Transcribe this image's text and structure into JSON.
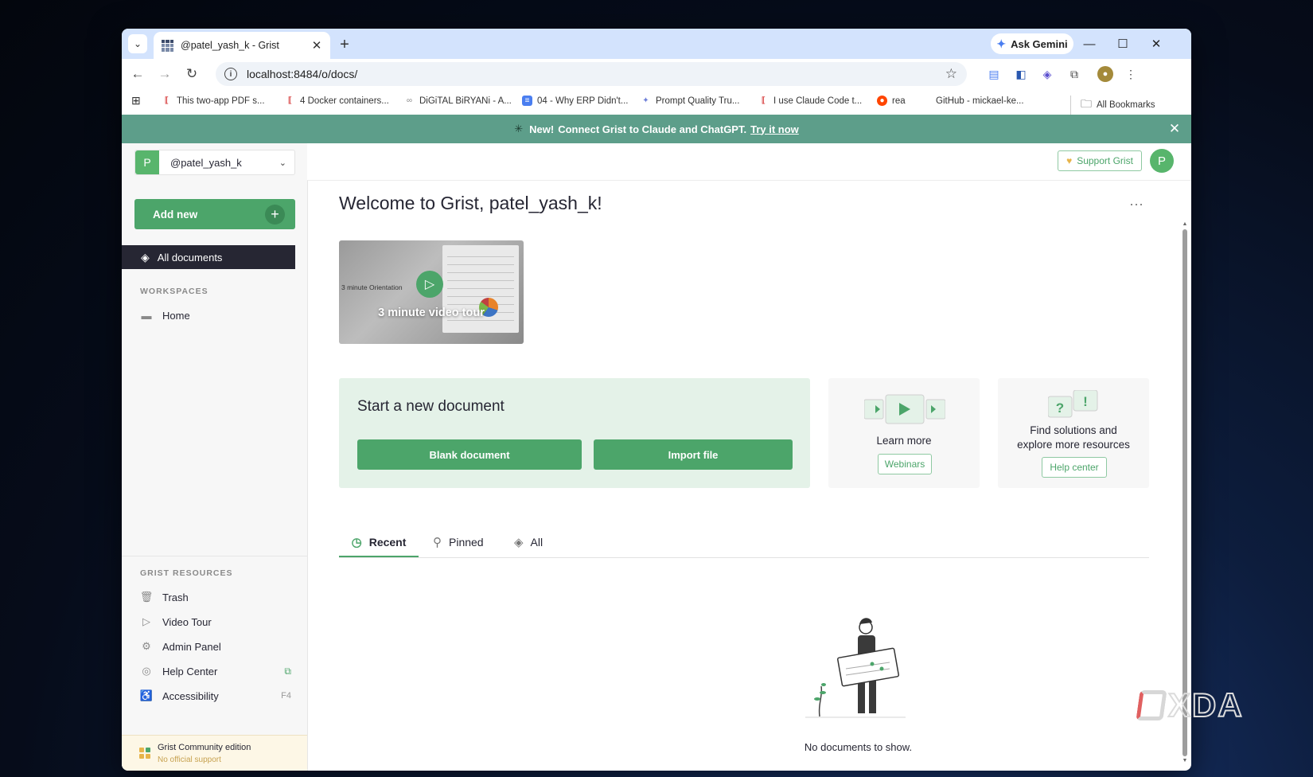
{
  "browser": {
    "tab_title": "@patel_yash_k - Grist",
    "tab_close": "✕",
    "new_tab": "+",
    "tab_search": "⌄",
    "ask_gemini": "Ask Gemini",
    "url": "localhost:8484/o/docs/",
    "window_controls": {
      "minimize": "—",
      "maximize": "☐",
      "close": "✕"
    },
    "bookmarks": [
      {
        "label": "This two-app PDF s...",
        "icon": "xda-icon",
        "color": "#d94848"
      },
      {
        "label": "4 Docker containers...",
        "icon": "xda-icon",
        "color": "#d94848"
      },
      {
        "label": "DiGiTAL BiRYANi - A...",
        "icon": "glasses-icon",
        "color": "#888888"
      },
      {
        "label": "04 - Why ERP Didn't...",
        "icon": "docs-icon",
        "color": "#4a7ef0"
      },
      {
        "label": "Prompt Quality Tru...",
        "icon": "sparkle-icon",
        "color": "#6e7fd8"
      },
      {
        "label": "I use Claude Code t...",
        "icon": "xda-icon",
        "color": "#d94848"
      },
      {
        "label": "rea",
        "icon": "reddit-icon",
        "color": "#ff4500"
      },
      {
        "label": "GitHub - mickael-ke...",
        "icon": "github-icon",
        "color": "#ffffff"
      }
    ],
    "all_bookmarks": "All Bookmarks"
  },
  "banner": {
    "new_label": "New!",
    "message": "Connect Grist to Claude and ChatGPT.",
    "link": "Try it now"
  },
  "sidebar": {
    "account_initial": "P",
    "account_name": "@patel_yash_k",
    "add_new": "Add new",
    "all_documents": "All documents",
    "workspaces_heading": "WORKSPACES",
    "home": "Home",
    "resources_heading": "GRIST RESOURCES",
    "resources": [
      {
        "label": "Trash",
        "icon": "trash-icon"
      },
      {
        "label": "Video Tour",
        "icon": "video-icon"
      },
      {
        "label": "Admin Panel",
        "icon": "gear-icon"
      },
      {
        "label": "Help Center",
        "icon": "help-icon"
      },
      {
        "label": "Accessibility",
        "icon": "accessibility-icon",
        "shortcut": "F4"
      }
    ],
    "community_title": "Grist Community edition",
    "community_sub": "No official support"
  },
  "header": {
    "support": "Support Grist",
    "user_initial": "P"
  },
  "main": {
    "welcome": "Welcome to Grist, patel_yash_k!",
    "video": {
      "title": "3 minute video tour",
      "thumb_label": "3 minute Orientation"
    },
    "start": {
      "title": "Start a new document",
      "blank": "Blank document",
      "import": "Import file"
    },
    "learn": {
      "title": "Learn more",
      "button": "Webinars"
    },
    "help": {
      "title_line1": "Find solutions and",
      "title_line2": "explore more resources",
      "button": "Help center"
    },
    "tabs": [
      {
        "label": "Recent",
        "active": true
      },
      {
        "label": "Pinned",
        "active": false
      },
      {
        "label": "All",
        "active": false
      }
    ],
    "empty": "No documents to show."
  },
  "colors": {
    "accent": "#4ca56a",
    "banner": "#5d9e8a",
    "dark_nav": "#262633",
    "tabstrip": "#d3e3fd"
  }
}
